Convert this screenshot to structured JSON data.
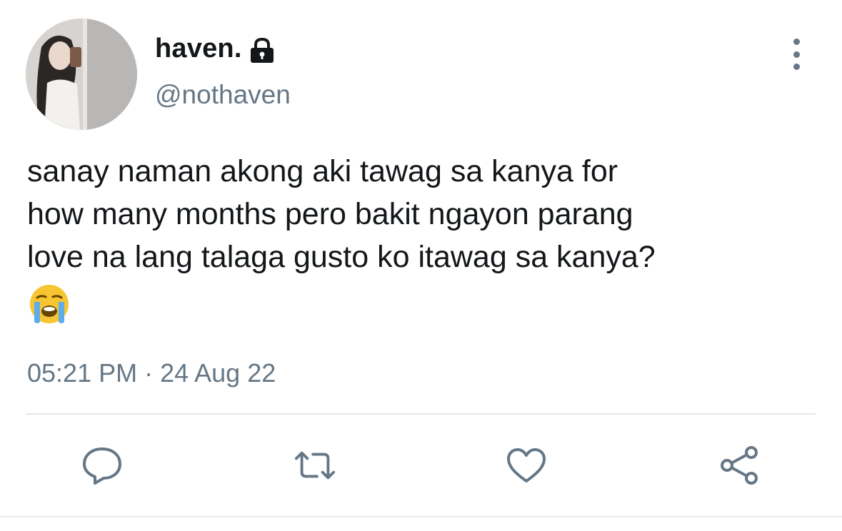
{
  "user": {
    "display_name": "haven.",
    "handle": "@nothaven",
    "protected": true
  },
  "tweet": {
    "text": "sanay naman akong aki tawag sa kanya for\nhow many months pero bakit ngayon parang\nlove na lang talaga gusto ko itawag sa kanya?",
    "emoji": "loudly-crying-face",
    "timestamp": "05:21 PM · 24 Aug 22"
  },
  "actions": [
    "reply-icon",
    "retweet-icon",
    "like-icon",
    "share-icon"
  ],
  "colors": {
    "text": "#14171a",
    "secondary": "#657786",
    "divider": "#e1e8ed"
  }
}
